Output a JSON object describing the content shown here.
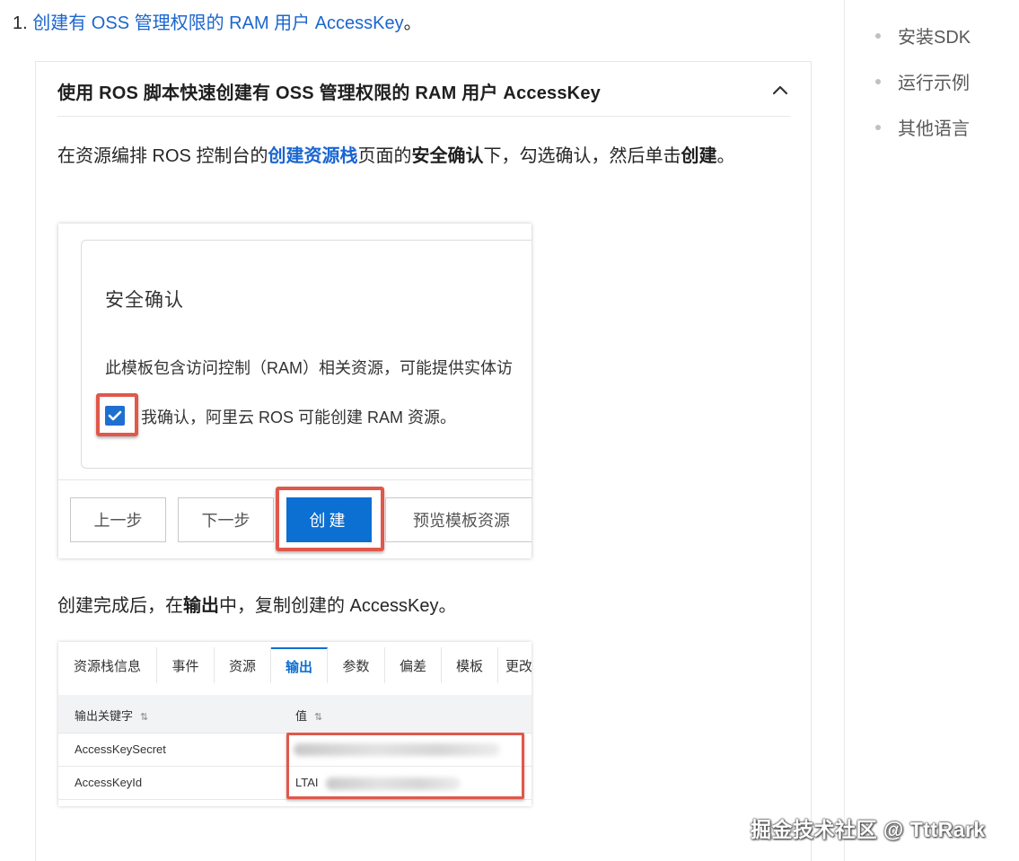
{
  "step": {
    "number": "1.",
    "link_text": "创建有 OSS 管理权限的 RAM 用户 AccessKey",
    "suffix": "。"
  },
  "toc": {
    "items": [
      "安装SDK",
      "运行示例",
      "其他语言"
    ]
  },
  "panel": {
    "title": "使用 ROS 脚本快速创建有 OSS 管理权限的 RAM 用户 AccessKey",
    "para1": {
      "t1": "在资源编排 ROS 控制台的",
      "link": "创建资源栈",
      "t2": "页面的",
      "b1": "安全确认",
      "t3": "下，勾选确认，然后单击",
      "b2": "创建",
      "t4": "。"
    },
    "para2": {
      "t1": "创建完成后，在",
      "b1": "输出",
      "t2": "中，复制创建的 AccessKey。"
    }
  },
  "shot1": {
    "dialog_title": "安全确认",
    "dialog_text": "此模板包含访问控制（RAM）相关资源，可能提供实体访",
    "checkbox_label": "我确认，阿里云 ROS 可能创建 RAM 资源。",
    "buttons": {
      "prev": "上一步",
      "next": "下一步",
      "create": "创建",
      "preview": "预览模板资源"
    }
  },
  "shot2": {
    "tabs": [
      "资源栈信息",
      "事件",
      "资源",
      "输出",
      "参数",
      "偏差",
      "模板",
      "更改"
    ],
    "active_tab": "输出",
    "headers": {
      "key": "输出关键字",
      "value": "值",
      "sort_glyph": "⇅"
    },
    "rows": [
      {
        "key": "AccessKeySecret",
        "value": ""
      },
      {
        "key": "AccessKeyId",
        "value": "LTAI"
      }
    ]
  },
  "watermark": "掘金技术社区 @ TttRark",
  "colors": {
    "link": "#1a66d1",
    "primary_button": "#0c6fd2",
    "highlight_box": "#e0584b"
  }
}
